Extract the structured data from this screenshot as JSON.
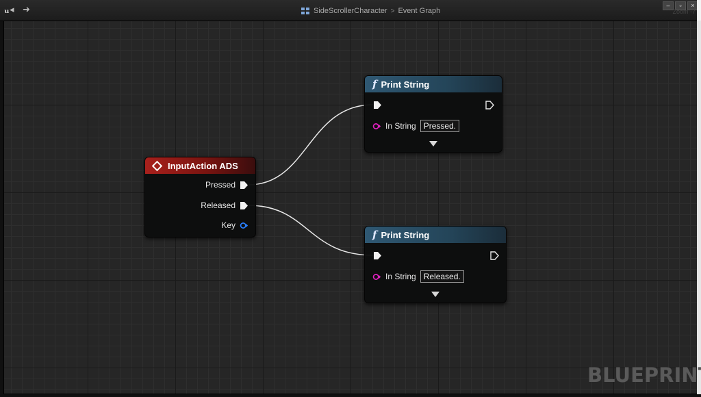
{
  "breadcrumb": {
    "asset": "SideScrollerCharacter",
    "separator": ">",
    "graph": "Event Graph"
  },
  "window_controls": [
    "–",
    "▫",
    "×"
  ],
  "zoom": "Zoom -7",
  "nodes": {
    "input_action": {
      "title": "InputAction ADS",
      "pins": {
        "pressed": "Pressed",
        "released": "Released",
        "key": "Key"
      }
    },
    "print_pressed": {
      "title": "Print String",
      "in_label": "In String",
      "value": "Pressed."
    },
    "print_released": {
      "title": "Print String",
      "in_label": "In String",
      "value": "Released."
    }
  },
  "watermark": "BLUEPRINT",
  "colors": {
    "event_header": "#a8201c",
    "function_header": "#2f5873",
    "string_pin": "#e020c0",
    "key_pin": "#2a7fff"
  }
}
